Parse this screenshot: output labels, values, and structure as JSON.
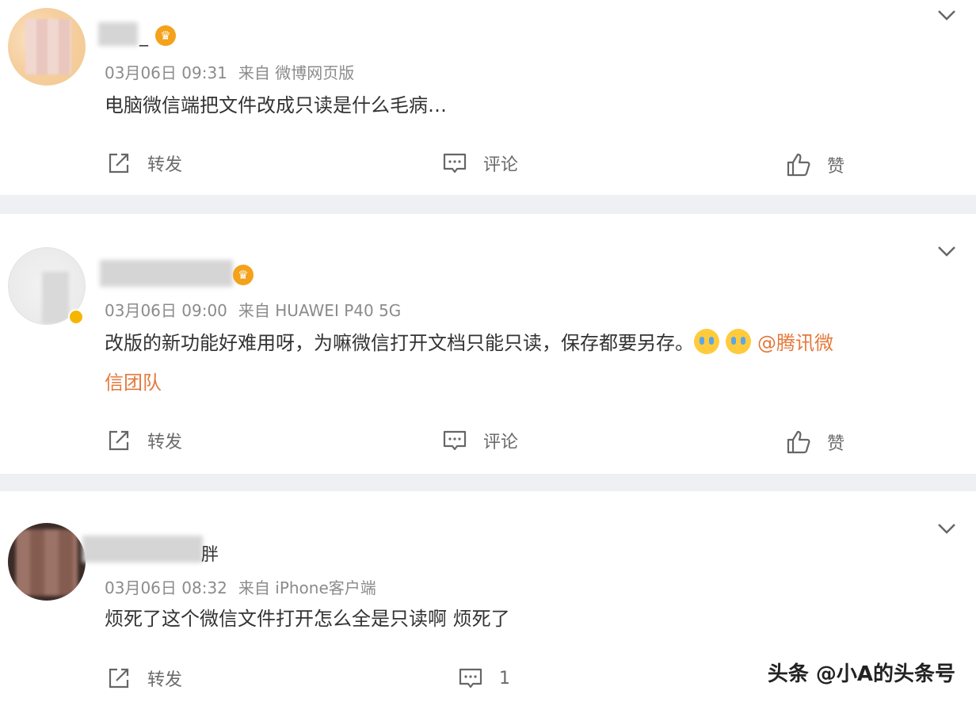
{
  "posts": [
    {
      "name_tail": "_",
      "meta": {
        "date": "03月06日 09:31",
        "source": "来自 微博网页版"
      },
      "content": "电脑微信端把文件改成只读是什么毛病…",
      "actions": {
        "forward": "转发",
        "comment": "评论",
        "like": "赞"
      }
    },
    {
      "meta": {
        "date": "03月06日 09:00",
        "source": "来自 HUAWEI P40 5G"
      },
      "content_line1": "改版的新功能好难用呀，为嘛微信打开文档只能只读，保存都要另存。",
      "mention_part1": "@腾讯微",
      "mention_part2": "信团队",
      "actions": {
        "forward": "转发",
        "comment": "评论",
        "like": "赞"
      }
    },
    {
      "name_tail": "胖",
      "meta": {
        "date": "03月06日 08:32",
        "source": "来自 iPhone客户端"
      },
      "content": "烦死了这个微信文件打开怎么全是只读啊 烦死了",
      "actions": {
        "forward": "转发",
        "comment_count": "1"
      }
    }
  ],
  "watermark": "头条 @小A的头条号",
  "icons": {
    "crown": "crown-badge-icon",
    "chevron": "chevron-down-icon",
    "forward": "forward-icon",
    "comment": "comment-icon",
    "like": "thumbs-up-icon",
    "emoji": "crying-emoji-icon"
  },
  "colors": {
    "mention": "#e4793b",
    "meta": "#8b8b8b",
    "divider": "#eef0f3"
  }
}
